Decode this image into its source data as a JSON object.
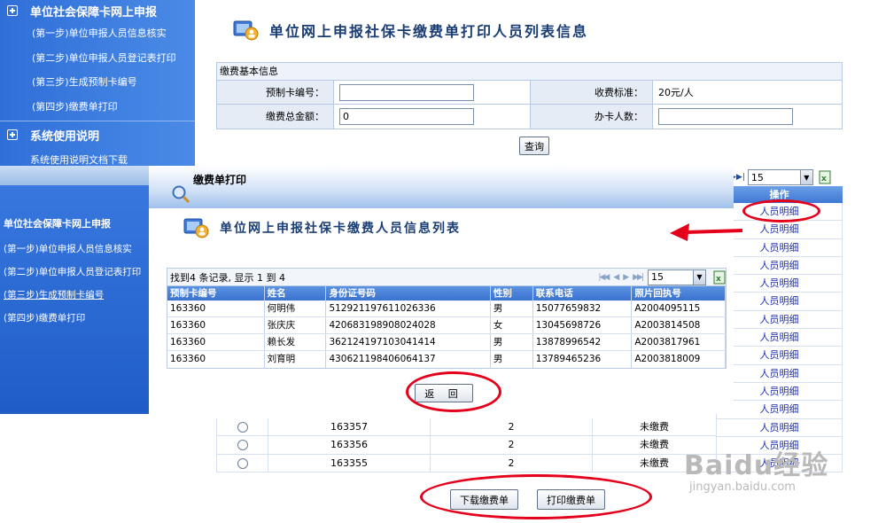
{
  "bg_sidebar": {
    "section1_title": "单位社会保障卡网上申报",
    "items": [
      "(第一步)单位申报人员信息核实",
      "(第二步)单位申报人员登记表打印",
      "(第三步)生成预制卡编号",
      "(第四步)缴费单打印"
    ],
    "section2_title": "系统使用说明",
    "section2_item": "系统使用说明文档下载"
  },
  "main": {
    "title": "单位网上申报社保卡缴费单打印人员列表信息",
    "form": {
      "header": "缴费基本信息",
      "card_no_label": "预制卡编号：",
      "card_no_value": "",
      "fee_std_label": "收费标准：",
      "fee_std_value": "20元/人",
      "total_label": "缴费总金额：",
      "total_value": "0",
      "count_label": "办卡人数：",
      "count_value": ""
    },
    "query_button": "查询",
    "page_size": "15",
    "ops_header": "操作",
    "ops_link": "人员明细",
    "rows": [
      {
        "card": "163357",
        "count": "2",
        "status": "未缴费"
      },
      {
        "card": "163356",
        "count": "2",
        "status": "未缴费"
      },
      {
        "card": "163355",
        "count": "2",
        "status": "未缴费"
      }
    ],
    "download_button": "下载缴费单",
    "print_button": "打印缴费单"
  },
  "overlay_sidebar": {
    "title": "单位社会保障卡网上申报",
    "items": [
      "(第一步)单位申报人员信息核实",
      "(第二步)单位申报人员登记表打印",
      "(第三步)生成预制卡编号",
      "(第四步)缴费单打印"
    ]
  },
  "dialog": {
    "bar_title": "缴费单打印",
    "title": "单位网上申报社保卡缴费人员信息列表",
    "record_info": "找到4 条记录, 显示 1 到 4",
    "page_size": "15",
    "columns": [
      "预制卡编号",
      "姓名",
      "身份证号码",
      "性别",
      "联系电话",
      "照片回执号"
    ],
    "rows": [
      [
        "163360",
        "何明伟",
        "512921197611026336",
        "男",
        "15077659832",
        "A2004095115"
      ],
      [
        "163360",
        "张庆庆",
        "420683198908024028",
        "女",
        "13045698726",
        "A2003814508"
      ],
      [
        "163360",
        "赖长发",
        "362124197103041414",
        "男",
        "13878996542",
        "A2003817961"
      ],
      [
        "163360",
        "刘育明",
        "430621198406064137",
        "男",
        "13789465236",
        "A2003818009"
      ]
    ],
    "back_button": "返 回"
  },
  "watermark": {
    "big": "Baidu经验",
    "small": "jingyan.baidu.com"
  },
  "colors": {
    "sidebar": "#2f6fd8",
    "header": "#1a3d73",
    "annotation": "#e4001b",
    "link": "#1d2fb5"
  }
}
